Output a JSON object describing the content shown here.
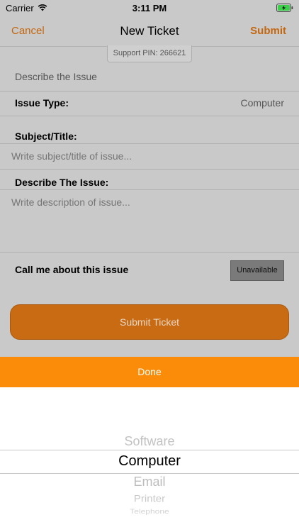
{
  "status_bar": {
    "carrier": "Carrier",
    "time": "3:11 PM"
  },
  "nav": {
    "cancel": "Cancel",
    "title": "New Ticket",
    "submit": "Submit"
  },
  "support_pin": "Support PIN: 266621",
  "describe_issue_header": "Describe the Issue",
  "issue_type": {
    "label": "Issue Type:",
    "value": "Computer"
  },
  "subject": {
    "label": "Subject/Title:",
    "placeholder": "Write subject/title of issue..."
  },
  "description": {
    "label": "Describe The Issue:",
    "placeholder": "Write description of issue..."
  },
  "call_me": {
    "label": "Call me about this issue",
    "button": "Unavailable"
  },
  "submit_ticket": "Submit Ticket",
  "picker": {
    "done": "Done",
    "options": [
      "Software",
      "Computer",
      "Email",
      "Printer",
      "Telephone"
    ],
    "selected": "Computer"
  },
  "colors": {
    "accent": "#c4670f",
    "done_bar": "#fb8c0a",
    "submit_button": "#c96b12",
    "dim_overlay": "#c9c9c9"
  }
}
